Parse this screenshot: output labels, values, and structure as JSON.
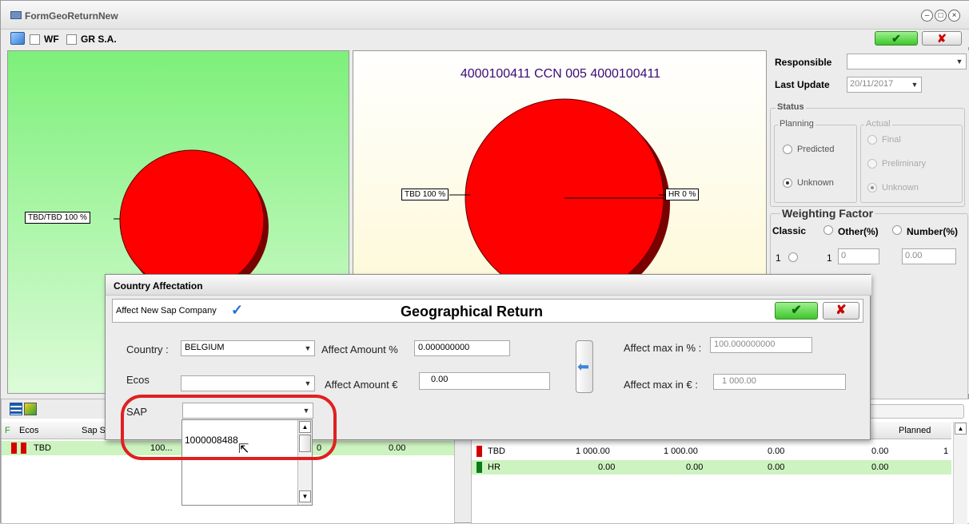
{
  "window": {
    "title": "FormGeoReturnNew"
  },
  "toolbar": {
    "wf_label": "WF",
    "grsa_label": "GR S.A."
  },
  "chart": {
    "title": "4000100411 CCN 005 4000100411",
    "left_label": "TBD/TBD 100 %",
    "mid_label_left": "TBD 100 %",
    "mid_label_right": "HR 0 %",
    "pie_color": "#ff0000",
    "chart_data": [
      {
        "type": "pie",
        "title": "",
        "categories": [
          "TBD/TBD"
        ],
        "values": [
          100
        ]
      },
      {
        "type": "pie",
        "title": "4000100411 CCN 005 4000100411",
        "categories": [
          "TBD",
          "HR"
        ],
        "values": [
          100,
          0
        ]
      }
    ]
  },
  "right": {
    "responsible_label": "Responsible",
    "responsible_value": "",
    "last_update_label": "Last Update",
    "last_update_value": "20/11/2017",
    "status_title": "Status",
    "planning_title": "Planning",
    "actual_title": "Actual",
    "predicted": "Predicted",
    "unknown": "Unknown",
    "final": "Final",
    "preliminary": "Preliminary",
    "actual_unknown": "Unknown",
    "weighting_title": "Weighting Factor",
    "classic": "Classic",
    "other": "Other(%)",
    "number": "Number(%)",
    "classic_value": "1",
    "other_value": "1",
    "other_field": "0",
    "number_field": "0.00"
  },
  "dialog": {
    "title": "Country Affectation",
    "affect_new": "Affect New Sap Company",
    "header": "Geographical Return",
    "country_label": "Country :",
    "country_value": "BELGIUM",
    "ecos_label": "Ecos",
    "ecos_value": "",
    "sap_label": "SAP",
    "sap_value": "",
    "sap_options": [
      "1000008488"
    ],
    "affect_pct_label": "Affect Amount %",
    "affect_pct_value": "0.000000000",
    "affect_eur_label": "Affect Amount €",
    "affect_eur_value": "0.00",
    "max_pct_label": "Affect max in % :",
    "max_pct_value": "100.000000000",
    "max_eur_label": "Affect max in € :",
    "max_eur_value": "1 000.00"
  },
  "grid_left": {
    "col_f": "F",
    "col_ecos": "Ecos",
    "col_sap": "Sap S",
    "row1": {
      "ecos": "TBD",
      "sap": "100...",
      "amount": "0.00",
      "hidden": "0"
    }
  },
  "grid_right": {
    "col_planned": "Planned",
    "rows": [
      {
        "name": "TBD",
        "c1": "1 000.00",
        "c2": "1 000.00",
        "c3": "0.00",
        "c4": "0.00",
        "c5": "1"
      },
      {
        "name": "HR",
        "c1": "0.00",
        "c2": "0.00",
        "c3": "0.00",
        "c4": "0.00",
        "c5": ""
      }
    ]
  }
}
